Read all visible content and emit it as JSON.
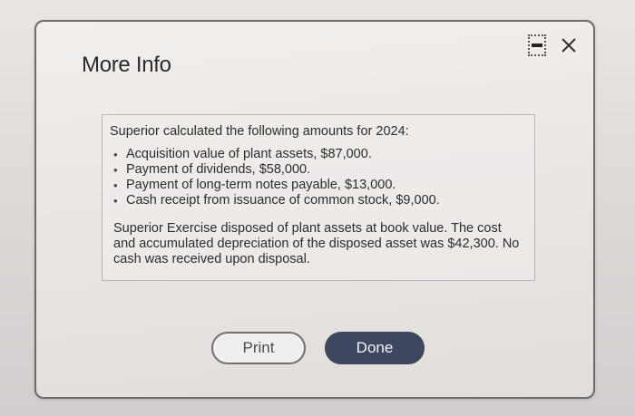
{
  "dialog": {
    "title": "More Info",
    "controls": {
      "minimize_icon": "minimize-icon",
      "close_icon": "close-icon"
    }
  },
  "info": {
    "intro": "Superior calculated the following amounts for 2024:",
    "bullets": [
      "Acquisition value of plant assets, $87,000.",
      "Payment of dividends, $58,000.",
      "Payment of long-term notes payable, $13,000.",
      "Cash receipt from issuance of common stock, $9,000."
    ],
    "note": "Superior Exercise disposed of plant assets at book value. The cost and accumulated depreciation of the disposed asset was $42,300. No cash was received upon disposal."
  },
  "buttons": {
    "print_label": "Print",
    "done_label": "Done"
  },
  "colors": {
    "done_button": "#3d4860",
    "dialog_border": "#6b6b70"
  }
}
